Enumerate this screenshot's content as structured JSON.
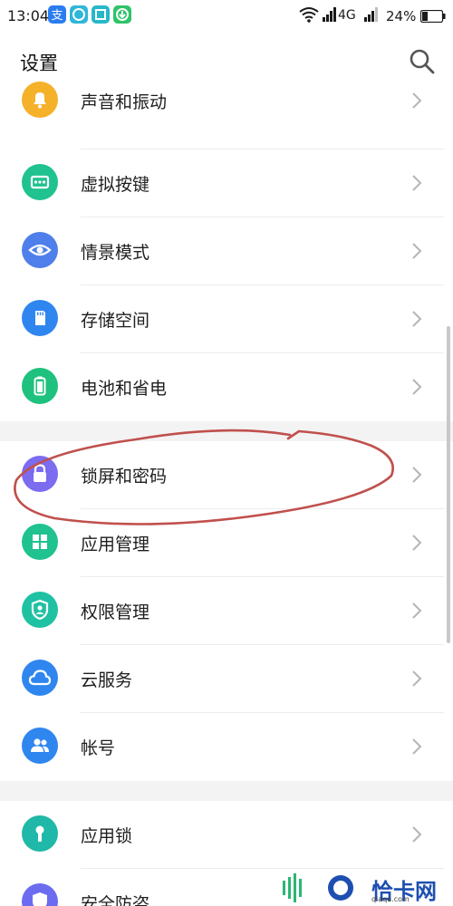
{
  "status_bar": {
    "time": "13:04",
    "network": "4G",
    "battery": "24%"
  },
  "header": {
    "title": "设置"
  },
  "settings": {
    "items": [
      {
        "label": "声音和振动",
        "icon": "bell-icon",
        "color": "#f5b12a"
      },
      {
        "label": "虚拟按键",
        "icon": "virtual-keys-icon",
        "color": "#20c28f"
      },
      {
        "label": "情景模式",
        "icon": "eye-icon",
        "color": "#4f7fea"
      },
      {
        "label": "存储空间",
        "icon": "sd-card-icon",
        "color": "#2f86ef"
      },
      {
        "label": "电池和省电",
        "icon": "battery-icon",
        "color": "#1fc17e"
      },
      {
        "label": "锁屏和密码",
        "icon": "lock-icon",
        "color": "#7b6cf0"
      },
      {
        "label": "应用管理",
        "icon": "grid-icon",
        "color": "#20c28f"
      },
      {
        "label": "权限管理",
        "icon": "shield-user-icon",
        "color": "#1fc1a3"
      },
      {
        "label": "云服务",
        "icon": "cloud-icon",
        "color": "#2f86ef"
      },
      {
        "label": "帐号",
        "icon": "people-icon",
        "color": "#2f86ef"
      },
      {
        "label": "应用锁",
        "icon": "keyhole-icon",
        "color": "#20b8a8"
      },
      {
        "label": "安全防盗",
        "icon": "shield-icon",
        "color": "#6c6cf0"
      }
    ]
  },
  "watermark": {
    "text": "恰卡网",
    "sub": "qiaqa.com"
  },
  "colors": {
    "annotation": "#c0504d",
    "divider": "#ececec",
    "group_gap": "#f3f3f3"
  }
}
